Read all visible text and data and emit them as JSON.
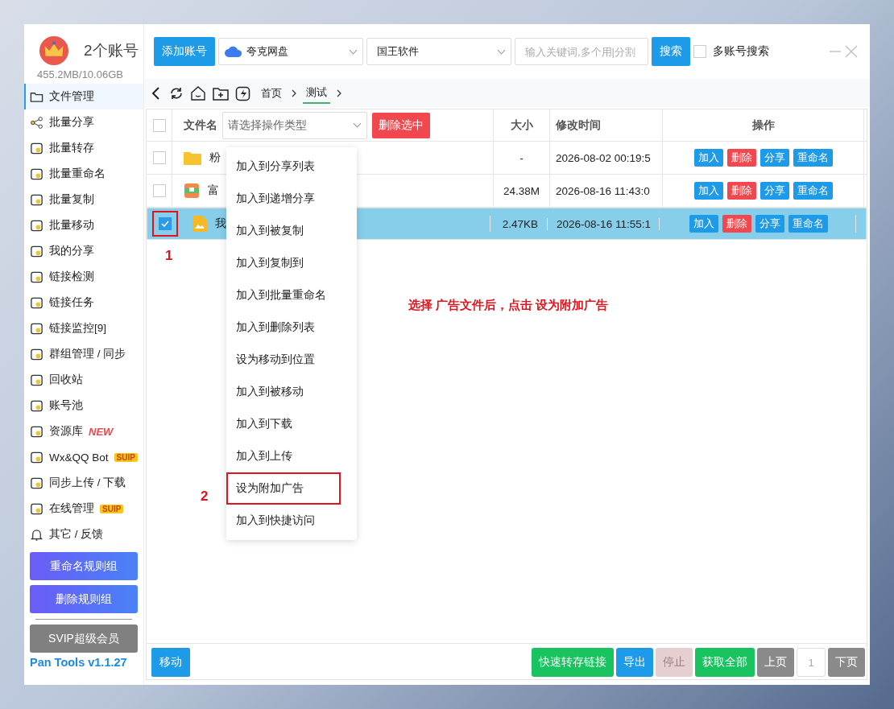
{
  "window": {
    "account_count": "2个账号",
    "storage": "455.2MB/10.06GB"
  },
  "sidebar": {
    "items": [
      {
        "label": "文件管理",
        "selected": true
      },
      {
        "label": "批量分享",
        "selected": false
      },
      {
        "label": "批量转存",
        "selected": false
      },
      {
        "label": "批量重命名",
        "selected": false
      },
      {
        "label": "批量复制",
        "selected": false
      },
      {
        "label": "批量移动",
        "selected": false
      },
      {
        "label": "我的分享",
        "selected": false
      },
      {
        "label": "链接检测",
        "selected": false
      },
      {
        "label": "链接任务",
        "selected": false
      },
      {
        "label": "链接监控[9]",
        "selected": false
      },
      {
        "label": "群组管理 / 同步",
        "selected": false
      },
      {
        "label": "回收站",
        "selected": false
      },
      {
        "label": "账号池",
        "selected": false
      },
      {
        "label": "资源库",
        "selected": false,
        "badge": {
          "kind": "new",
          "text": "NEW"
        }
      },
      {
        "label": "Wx&QQ Bot",
        "selected": false,
        "badge": {
          "kind": "suip",
          "text": "SUIP"
        }
      },
      {
        "label": "同步上传 / 下载",
        "selected": false
      },
      {
        "label": "在线管理",
        "selected": false,
        "badge": {
          "kind": "suip",
          "text": "SUIP"
        }
      },
      {
        "label": "其它 / 反馈",
        "selected": false
      }
    ],
    "buttons": [
      "重命名规则组",
      "删除规则组"
    ],
    "vip_button": "SVIP超级会员",
    "version": "Pan Tools v1.1.27"
  },
  "toolbar": {
    "add_account": "添加账号",
    "drive_select": "夸克网盘",
    "category_select": "国王软件",
    "search": {
      "placeholder": "输入关键词,多个用|分割"
    },
    "search_button": "搜索",
    "multi_account": {
      "label": "多账号搜索",
      "checked": false
    }
  },
  "breadcrumbs": [
    {
      "label": "首页",
      "selected": false
    },
    {
      "label": "测试",
      "selected": true
    }
  ],
  "table": {
    "select_all_checked": false,
    "columns": {
      "name": "文件名",
      "op_type": {
        "placeholder": "请选择操作类型"
      },
      "delete_selected": "删除选中",
      "size": "大小",
      "mtime": "修改时间",
      "actions": "操作"
    },
    "rows": [
      {
        "kind": "folder",
        "name": "粉",
        "size": "-",
        "mtime": "2026-08-02 00:19:5",
        "checked": false,
        "selected": false,
        "outlined": false,
        "actions": [
          "加入",
          "删除",
          "分享",
          "重命名"
        ]
      },
      {
        "kind": "archive",
        "name": "富",
        "size": "24.38M",
        "mtime": "2026-08-16 11:43:0",
        "checked": false,
        "selected": false,
        "outlined": false,
        "actions": [
          "加入",
          "删除",
          "分享",
          "重命名"
        ]
      },
      {
        "kind": "image",
        "name": "我",
        "size": "2.47KB",
        "mtime": "2026-08-16 11:55:1",
        "checked": true,
        "selected": true,
        "outlined": true,
        "marker": "1",
        "actions": [
          "加入",
          "删除",
          "分享",
          "重命名"
        ]
      }
    ]
  },
  "context_menu": {
    "items": [
      {
        "label": "加入到分享列表",
        "outlined": false
      },
      {
        "label": "加入到递增分享",
        "outlined": false
      },
      {
        "label": "加入到被复制",
        "outlined": false
      },
      {
        "label": "加入到复制到",
        "outlined": false
      },
      {
        "label": "加入到批量重命名",
        "outlined": false
      },
      {
        "label": "加入到删除列表",
        "outlined": false
      },
      {
        "label": "设为移动到位置",
        "outlined": false
      },
      {
        "label": "加入到被移动",
        "outlined": false
      },
      {
        "label": "加入到下载",
        "outlined": false
      },
      {
        "label": "加入到上传",
        "outlined": false
      },
      {
        "label": "设为附加广告",
        "outlined": true,
        "marker": "2"
      },
      {
        "label": "加入到快捷访问",
        "outlined": false
      }
    ]
  },
  "note": "选择 广告文件后，点击 设为附加广告",
  "bottom_bar": {
    "move": "移动",
    "buttons": [
      {
        "label": "快速转存链接",
        "kind": "success",
        "disabled": false
      },
      {
        "label": "导出",
        "kind": "primary",
        "disabled": false
      },
      {
        "label": "停止",
        "kind": "danger",
        "disabled": true
      },
      {
        "label": "获取全部",
        "kind": "success",
        "disabled": false
      },
      {
        "label": "上页",
        "kind": "gray",
        "disabled": false
      }
    ],
    "page": "1",
    "next": "下页"
  }
}
